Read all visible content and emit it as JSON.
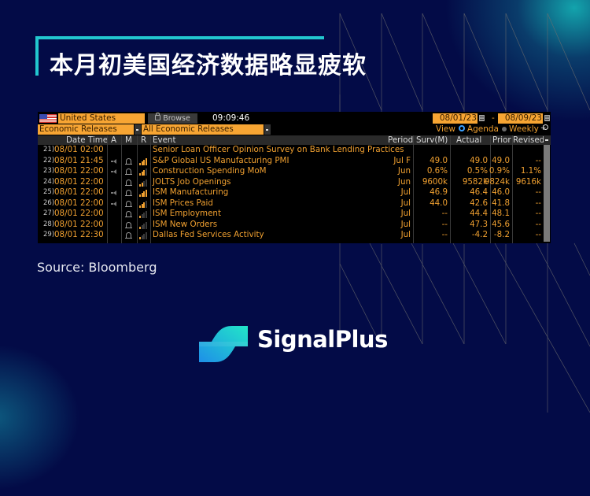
{
  "page": {
    "title": "本月初美国经济数据略显疲软",
    "source": "Source: Bloomberg",
    "brand": "SignalPlus",
    "colors": {
      "background": "#030b47",
      "accent": "#22c7cf",
      "terminal_orange": "#f0a030",
      "field_orange": "#f7a533"
    }
  },
  "terminal": {
    "country": "United States",
    "browse_label": "Browse",
    "time": "09:09:46",
    "date_from": "08/01/23",
    "date_separator": "-",
    "date_to": "08/09/23",
    "category": "Economic Releases",
    "filter": "All Economic Releases",
    "view_label": "View",
    "view_options": [
      {
        "label": "Agenda",
        "selected": true
      },
      {
        "label": "Weekly",
        "selected": false
      }
    ],
    "columns": {
      "date_time": "Date Time",
      "a": "A",
      "m": "M",
      "r": "R",
      "event": "Event",
      "period": "Period",
      "survey": "Surv(M)",
      "actual": "Actual",
      "prior": "Prior",
      "revised": "Revised"
    },
    "rows": [
      {
        "num": "21)",
        "datetime": "08/01 02:00",
        "alert": false,
        "bell": false,
        "relevance": 0,
        "event": "Senior Loan Officer Opinion Survey on Bank Lending Practices",
        "period": "",
        "survey": "",
        "actual": "",
        "prior": "",
        "revised": ""
      },
      {
        "num": "22)",
        "datetime": "08/01 21:45",
        "alert": true,
        "bell": true,
        "relevance": 4,
        "event": "S&P Global US Manufacturing PMI",
        "period": "Jul F",
        "survey": "49.0",
        "actual": "49.0",
        "prior": "49.0",
        "revised": "--"
      },
      {
        "num": "23)",
        "datetime": "08/01 22:00",
        "alert": true,
        "bell": true,
        "relevance": 3,
        "event": "Construction Spending MoM",
        "period": "Jun",
        "survey": "0.6%",
        "actual": "0.5%",
        "prior": "0.9%",
        "revised": "1.1%"
      },
      {
        "num": "24)",
        "datetime": "08/01 22:00",
        "alert": false,
        "bell": true,
        "relevance": 2,
        "event": "JOLTS Job Openings",
        "period": "Jun",
        "survey": "9600k",
        "actual": "9582k",
        "prior": "9824k",
        "revised": "9616k"
      },
      {
        "num": "25)",
        "datetime": "08/01 22:00",
        "alert": true,
        "bell": true,
        "relevance": 4,
        "event": "ISM Manufacturing",
        "period": "Jul",
        "survey": "46.9",
        "actual": "46.4",
        "prior": "46.0",
        "revised": "--"
      },
      {
        "num": "26)",
        "datetime": "08/01 22:00",
        "alert": true,
        "bell": true,
        "relevance": 3,
        "event": "ISM Prices Paid",
        "period": "Jul",
        "survey": "44.0",
        "actual": "42.6",
        "prior": "41.8",
        "revised": "--"
      },
      {
        "num": "27)",
        "datetime": "08/01 22:00",
        "alert": false,
        "bell": true,
        "relevance": 1,
        "event": "ISM Employment",
        "period": "Jul",
        "survey": "--",
        "actual": "44.4",
        "prior": "48.1",
        "revised": "--"
      },
      {
        "num": "28)",
        "datetime": "08/01 22:00",
        "alert": false,
        "bell": true,
        "relevance": 1,
        "event": "ISM New Orders",
        "period": "Jul",
        "survey": "--",
        "actual": "47.3",
        "prior": "45.6",
        "revised": "--"
      },
      {
        "num": "29)",
        "datetime": "08/01 22:30",
        "alert": false,
        "bell": true,
        "relevance": 1,
        "event": "Dallas Fed Services Activity",
        "period": "Jul",
        "survey": "--",
        "actual": "-4.2",
        "prior": "-8.2",
        "revised": "--"
      }
    ]
  }
}
